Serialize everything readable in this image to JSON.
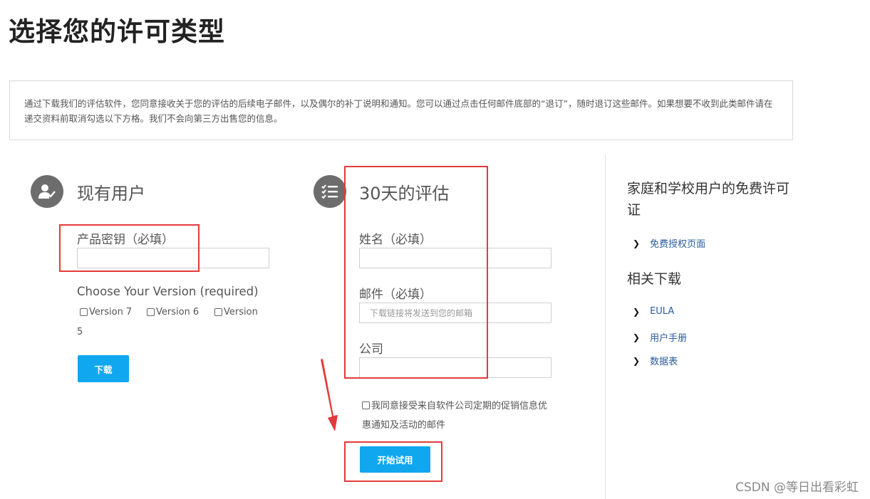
{
  "page_title": "选择您的许可类型",
  "notice_text": "通过下载我们的评估软件，您同意接收关于您的评估的后续电子邮件，以及偶尔的补丁说明和通知。您可以通过点击任何邮件底部的“退订”，随时退订这些邮件。如果想要不收到此类邮件请在递交资料前取消勾选以下方格。我们不会向第三方出售您的信息。",
  "existing": {
    "title": "现有用户",
    "product_key_label": "产品密钥（必填）",
    "product_key_value": "",
    "version_label": "Choose Your Version (required)",
    "versions": [
      "Version 7",
      "Version 6",
      "Version"
    ],
    "version_wrap": "5",
    "download_button": "下载"
  },
  "trial": {
    "title": "30天的评估",
    "name_label": "姓名（必填）",
    "name_value": "",
    "email_label": "邮件（必填）",
    "email_placeholder": "下载链接将发送到您的邮箱",
    "company_label": "公司",
    "company_value": "",
    "agree_text": "我同意接受来自软件公司定期的促销信息优惠通知及活动的邮件",
    "start_button": "开始试用"
  },
  "sidebar": {
    "free_license_title": "家庭和学校用户的免费许可证",
    "free_license_link": "免费授权页面",
    "downloads_title": "相关下载",
    "links": [
      "EULA",
      "用户手册",
      "数据表"
    ]
  },
  "watermark": "CSDN @等日出看彩虹",
  "colors": {
    "accent": "#10a7ef",
    "annotation": "#e23b3b",
    "icon_bg": "#6d6d6d"
  }
}
